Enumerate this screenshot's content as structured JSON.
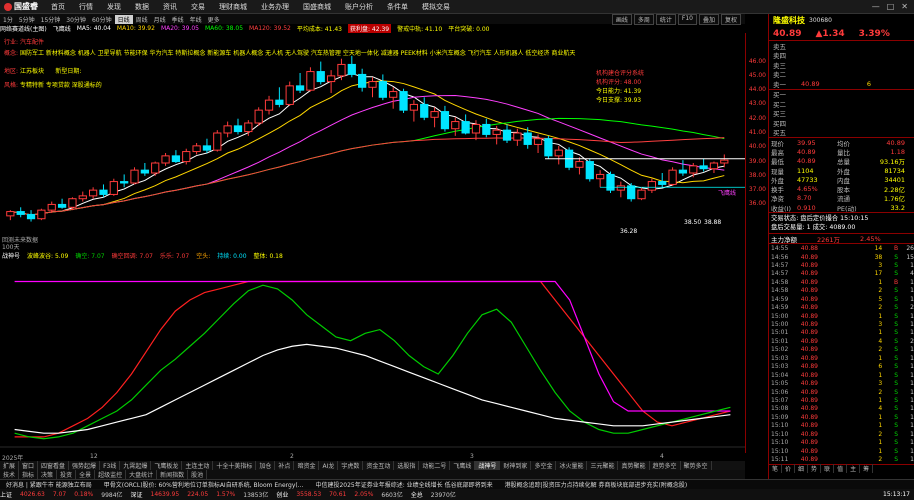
{
  "app": {
    "title": "国盛睿",
    "menu": [
      "首页",
      "行情",
      "发现",
      "数据",
      "资讯",
      "交易",
      "理财商城",
      "业务办理",
      "国盛商城",
      "账户分析",
      "条件单",
      "模拟交易"
    ]
  },
  "periods": [
    "1分",
    "5分钟",
    "15分钟",
    "30分钟",
    "60分钟",
    "日线",
    "周线",
    "月线",
    "季线",
    "年线",
    "更多"
  ],
  "period_active": "日线",
  "tools": [
    "画线",
    "多周",
    "统计",
    "F10",
    "叠加",
    "复权"
  ],
  "main_header": {
    "title": "网络赛道线(主图)",
    "ind1": "飞鹰线",
    "ma5": "MA5: 40.04",
    "ma10": "MA10: 39.92",
    "ma20": "MA20: 39.05",
    "ma60": "MA60: 38.05",
    "ma120": "MA120: 39.52",
    "avg": "平均成本: 41.43",
    "hl": "获利盘: 42.39",
    "warn": "警戒中轨: 41.10",
    "sup": "平台突破: 0.00"
  },
  "concepts": {
    "line1_label": "行业:",
    "line1": "汽车配件",
    "line2_label": "概念:",
    "line2": "国防军工 新材料概念 机器人 卫星导航 节能环保 华为汽车 特斯拉概念 新能源车 机器人概念 无人机 无人驾驶 汽车热管理 空天地一体化 减速器 PEEK材料 小米汽车概念 飞行汽车 人形机器人 低空经济 商业航天",
    "line3_label": "地区:",
    "line3": "江苏板块",
    "line3b": "新型日期:",
    "line4_label": "风格:",
    "line4": "专精特新 专项贷款 深股通标的"
  },
  "score": {
    "title": "机构建仓评分系统",
    "l1": "机构评分: 48.00",
    "l2": "今日能力: 41.39",
    "l3": "今日支撑: 39.93"
  },
  "annot": {
    "low": "36.28",
    "r1": "38.50",
    "r2": "38.88",
    "vol": "飞鹰线"
  },
  "chart_data": {
    "type": "candlestick",
    "ylim": [
      34,
      48
    ],
    "y_ticks": [
      46.0,
      45.0,
      44.0,
      43.0,
      42.0,
      41.0,
      40.0,
      39.0,
      38.0,
      37.0,
      36.0
    ],
    "candles": [
      [
        35.2,
        35.6,
        34.9,
        35.5
      ],
      [
        35.5,
        35.8,
        35.1,
        35.3
      ],
      [
        35.3,
        35.6,
        34.8,
        35.0
      ],
      [
        35.0,
        35.7,
        34.9,
        35.6
      ],
      [
        35.6,
        36.2,
        35.4,
        36.0
      ],
      [
        36.0,
        36.4,
        35.7,
        35.8
      ],
      [
        35.8,
        36.5,
        35.6,
        36.4
      ],
      [
        36.4,
        36.9,
        36.2,
        36.6
      ],
      [
        36.6,
        37.2,
        36.4,
        37.0
      ],
      [
        37.0,
        37.4,
        36.5,
        36.7
      ],
      [
        36.7,
        37.8,
        36.6,
        37.6
      ],
      [
        37.6,
        38.1,
        37.2,
        37.5
      ],
      [
        37.5,
        38.6,
        37.4,
        38.4
      ],
      [
        38.4,
        38.9,
        38.0,
        38.2
      ],
      [
        38.2,
        39.0,
        38.0,
        38.9
      ],
      [
        38.9,
        39.6,
        38.7,
        39.4
      ],
      [
        39.4,
        39.8,
        38.9,
        39.0
      ],
      [
        39.0,
        39.9,
        38.8,
        39.7
      ],
      [
        39.7,
        40.3,
        39.5,
        40.1
      ],
      [
        40.1,
        40.6,
        39.6,
        39.8
      ],
      [
        39.8,
        41.2,
        39.7,
        41.0
      ],
      [
        41.0,
        41.8,
        40.7,
        41.5
      ],
      [
        41.5,
        42.0,
        40.9,
        41.1
      ],
      [
        41.1,
        41.9,
        40.8,
        41.7
      ],
      [
        41.7,
        42.8,
        41.5,
        42.6
      ],
      [
        42.6,
        43.6,
        42.3,
        43.3
      ],
      [
        43.3,
        44.2,
        42.8,
        43.0
      ],
      [
        43.0,
        44.6,
        42.9,
        44.3
      ],
      [
        44.3,
        45.2,
        43.8,
        44.0
      ],
      [
        44.0,
        45.6,
        43.9,
        45.3
      ],
      [
        45.3,
        46.0,
        44.4,
        44.6
      ],
      [
        44.6,
        45.4,
        43.8,
        45.0
      ],
      [
        45.0,
        46.2,
        44.7,
        45.8
      ],
      [
        45.8,
        46.4,
        44.9,
        45.1
      ],
      [
        45.1,
        45.5,
        43.9,
        44.2
      ],
      [
        44.2,
        44.9,
        43.5,
        44.6
      ],
      [
        44.6,
        45.1,
        43.3,
        43.5
      ],
      [
        43.5,
        44.2,
        42.7,
        43.9
      ],
      [
        43.9,
        44.1,
        42.4,
        42.6
      ],
      [
        42.6,
        43.3,
        41.8,
        43.0
      ],
      [
        43.0,
        43.5,
        41.9,
        42.1
      ],
      [
        42.1,
        42.8,
        41.4,
        42.5
      ],
      [
        42.5,
        42.9,
        41.1,
        41.3
      ],
      [
        41.3,
        42.1,
        40.8,
        41.8
      ],
      [
        41.8,
        42.3,
        40.9,
        41.0
      ],
      [
        41.0,
        41.9,
        40.5,
        41.6
      ],
      [
        41.6,
        42.0,
        40.7,
        40.9
      ],
      [
        40.9,
        41.5,
        40.2,
        41.2
      ],
      [
        41.2,
        41.6,
        40.3,
        40.5
      ],
      [
        40.5,
        41.3,
        40.1,
        41.0
      ],
      [
        41.0,
        41.4,
        39.9,
        40.2
      ],
      [
        40.2,
        40.9,
        39.6,
        40.6
      ],
      [
        40.6,
        40.8,
        39.2,
        39.4
      ],
      [
        39.4,
        40.1,
        38.8,
        39.8
      ],
      [
        39.8,
        40.0,
        38.4,
        38.6
      ],
      [
        38.6,
        39.3,
        38.1,
        39.0
      ],
      [
        39.0,
        39.2,
        37.6,
        37.8
      ],
      [
        37.8,
        38.4,
        37.2,
        38.1
      ],
      [
        38.1,
        38.3,
        36.8,
        37.0
      ],
      [
        37.0,
        37.6,
        36.5,
        37.3
      ],
      [
        37.3,
        37.5,
        36.2,
        36.4
      ],
      [
        36.4,
        37.2,
        36.3,
        37.0
      ],
      [
        37.0,
        37.8,
        36.8,
        37.6
      ],
      [
        37.6,
        38.2,
        37.2,
        37.4
      ],
      [
        37.4,
        38.6,
        37.3,
        38.4
      ],
      [
        38.4,
        39.1,
        38.0,
        38.2
      ],
      [
        38.2,
        38.9,
        37.9,
        38.7
      ],
      [
        38.7,
        39.2,
        38.3,
        38.5
      ],
      [
        38.5,
        39.0,
        38.2,
        38.9
      ],
      [
        38.9,
        39.5,
        38.6,
        39.1
      ]
    ]
  },
  "sub": {
    "label": "回测未来数据",
    "label2": "100天",
    "ind": "战神号",
    "items": [
      "波峰波谷: 5.09",
      "确空: 7.07",
      "确空回调: 7.07",
      "乐乐: 7.07",
      "空头: ",
      "持续: 0.00",
      "整体: 0.18"
    ]
  },
  "osc_data": {
    "ylim": [
      0,
      100
    ],
    "white": [
      10,
      9,
      8,
      8,
      9,
      10,
      12,
      14,
      16,
      18,
      22,
      26,
      30,
      34,
      38,
      42,
      46,
      50,
      53,
      55,
      56,
      55,
      54,
      52,
      50,
      47,
      44,
      41,
      38,
      35,
      32,
      29,
      26,
      24,
      22,
      20,
      18,
      16,
      15,
      14,
      13,
      12,
      12,
      12,
      13,
      14,
      15,
      16,
      17,
      18
    ],
    "green": [
      8,
      6,
      5,
      6,
      8,
      12,
      16,
      20,
      26,
      34,
      42,
      48,
      55,
      62,
      70,
      78,
      85,
      88,
      86,
      80,
      72,
      66,
      60,
      58,
      62,
      64,
      58,
      50,
      44,
      40,
      50,
      62,
      72,
      75,
      68,
      55,
      42,
      30,
      20,
      14,
      10,
      8,
      8,
      10,
      12,
      14,
      16,
      18,
      20,
      22
    ],
    "magenta": [
      90,
      90,
      90,
      90,
      90,
      90,
      90,
      90,
      90,
      90,
      90,
      90,
      90,
      90,
      90,
      90,
      90,
      90,
      90,
      90,
      90,
      90,
      90,
      90,
      90,
      90,
      90,
      90,
      90,
      90,
      90,
      90,
      90,
      90,
      90,
      90,
      90,
      90,
      80,
      60,
      40,
      25,
      20,
      20,
      20,
      20,
      20,
      20,
      20,
      20
    ],
    "red": [
      6,
      6,
      6,
      8,
      12,
      16,
      22,
      30,
      40,
      52,
      64,
      74,
      80,
      84,
      86,
      88,
      90,
      90,
      90,
      90,
      90,
      90,
      90,
      90,
      90,
      90,
      90,
      90,
      90,
      90,
      90,
      90,
      90,
      90,
      90,
      90,
      90,
      80,
      70,
      60,
      50,
      40,
      30,
      20,
      14,
      12,
      14,
      16,
      18,
      20
    ]
  },
  "dates": {
    "d1": "2025年",
    "d2": "12",
    "d3": "2",
    "d4": "3",
    "d5": "4"
  },
  "tabs1": [
    "扩展",
    "窗口",
    "四窗看盘",
    "强势起爆",
    "F3线",
    "九霄起爆",
    "飞鹰板龙",
    "主连主动",
    "十全十美指标",
    "加仓",
    "补点",
    "暗资金",
    "AI龙",
    "宇虎数",
    "资金互动",
    "选股指",
    "动能二号",
    "飞鹰线",
    "战神号",
    "财神到家",
    "多空金",
    "冰火量能",
    "三元聚能",
    "真势聚能",
    "趋势多空",
    "聚势多空"
  ],
  "tabs1_active": "战神号",
  "tabs2": [
    "技术",
    "指标",
    "决策",
    "投资",
    "全景",
    "超级监控",
    "大盘统计",
    "新闻指数",
    "股池"
  ],
  "news": [
    "好消息 | 紧跟牛市 能源独立布局",
    "甲骨文(ORCL)股价: 60%营利地位订单指标AI自研系统, Bloom Energy(...",
    "中信建投2025年证券业年报综述: 业绩全线增长 低谷底部即将到来",
    "港股概念追踪|投资压力点持续化解 券商板块底部进步充实(附概念股)"
  ],
  "status": {
    "sh_label": "上证",
    "sh": "4026.63",
    "sh_chg": "7.07",
    "sh_pct": "0.18%",
    "sh_vol": "9984亿",
    "sz_label": "深证",
    "sz": "14639.95",
    "sz_chg": "224.05",
    "sz_pct": "1.57%",
    "sz_vol": "13853亿",
    "cyb_label": "创业",
    "cyb": "3558.53",
    "cyb_chg": "70.61",
    "cyb_pct": "2.05%",
    "cyb_vol": "6603亿",
    "total": "全总",
    "total_vol": "23970亿",
    "time": "15:13:17"
  },
  "quote": {
    "name": "隆盛科技",
    "code": "300680",
    "price": "40.89",
    "chg": "1.34",
    "pct": "3.39%",
    "ask": [
      [
        "卖五",
        "",
        ""
      ],
      [
        "卖四",
        "",
        ""
      ],
      [
        "卖三",
        "",
        ""
      ],
      [
        "卖二",
        "",
        ""
      ],
      [
        "卖一",
        "40.89",
        "6"
      ]
    ],
    "bid": [
      [
        "买一",
        "",
        ""
      ],
      [
        "买二",
        "",
        ""
      ],
      [
        "买三",
        "",
        ""
      ],
      [
        "买四",
        "",
        ""
      ],
      [
        "买五",
        "",
        ""
      ]
    ],
    "stats": [
      [
        "现价",
        "39.95",
        "均价",
        "40.89"
      ],
      [
        "最高",
        "40.89",
        "量比",
        "1.18"
      ],
      [
        "最低",
        "40.89",
        "总量",
        "93.16万"
      ],
      [
        "现量",
        "1104",
        "外盘",
        "81734"
      ],
      [
        "外盘",
        "47733",
        "内盘",
        "34401"
      ],
      [
        "换手",
        "4.65%",
        "股本",
        "2.28亿"
      ],
      [
        "净资",
        "8.70",
        "流通",
        "1.76亿"
      ],
      [
        "收益(Ⅰ)",
        "0.910",
        "PE(动)",
        "33.2"
      ]
    ],
    "status1": "交易状态: 盘后定价撮合 15:10:15",
    "status2": "盘后交易量: 1  成交: 4089.00",
    "flow_label": "主力净额",
    "flow": "2261万",
    "flow_pct": "2.45%",
    "trades": [
      [
        "14:55",
        "40.88",
        "14",
        "B",
        "26"
      ],
      [
        "14:56",
        "40.89",
        "38",
        "S",
        "15"
      ],
      [
        "14:57",
        "40.89",
        "3",
        "S",
        "1"
      ],
      [
        "14:57",
        "40.89",
        "17",
        "S",
        "4"
      ],
      [
        "14:58",
        "40.89",
        "1",
        "B",
        "1"
      ],
      [
        "14:58",
        "40.89",
        "2",
        "S",
        "1"
      ],
      [
        "14:59",
        "40.89",
        "5",
        "S",
        "1"
      ],
      [
        "14:59",
        "40.89",
        "2",
        "S",
        "2"
      ],
      [
        "15:00",
        "40.89",
        "1",
        "S",
        "1"
      ],
      [
        "15:00",
        "40.89",
        "3",
        "S",
        "1"
      ],
      [
        "15:01",
        "40.89",
        "1",
        "S",
        "1"
      ],
      [
        "15:01",
        "40.89",
        "4",
        "S",
        "2"
      ],
      [
        "15:02",
        "40.89",
        "2",
        "S",
        "1"
      ],
      [
        "15:03",
        "40.89",
        "1",
        "S",
        "1"
      ],
      [
        "15:03",
        "40.89",
        "6",
        "S",
        "1"
      ],
      [
        "15:04",
        "40.89",
        "1",
        "S",
        "1"
      ],
      [
        "15:05",
        "40.89",
        "3",
        "S",
        "1"
      ],
      [
        "15:06",
        "40.89",
        "2",
        "S",
        "1"
      ],
      [
        "15:07",
        "40.89",
        "1",
        "S",
        "1"
      ],
      [
        "15:08",
        "40.89",
        "4",
        "S",
        "1"
      ],
      [
        "15:09",
        "40.89",
        "1",
        "S",
        "1"
      ],
      [
        "15:10",
        "40.89",
        "1",
        "S",
        "1"
      ],
      [
        "15:10",
        "40.89",
        "2",
        "S",
        "1"
      ],
      [
        "15:10",
        "40.89",
        "1",
        "S",
        "1"
      ],
      [
        "15:10",
        "40.89",
        "1",
        "S",
        "1"
      ],
      [
        "15:11",
        "40.89",
        "2",
        "S",
        "1"
      ]
    ],
    "side_tabs": [
      "笔",
      "价",
      "细",
      "势",
      "联",
      "值",
      "主",
      "筹"
    ]
  },
  "colors": {
    "up": "#ff3b3b",
    "down": "#00e5ff",
    "bg": "#000000",
    "grid": "#8b0000"
  }
}
